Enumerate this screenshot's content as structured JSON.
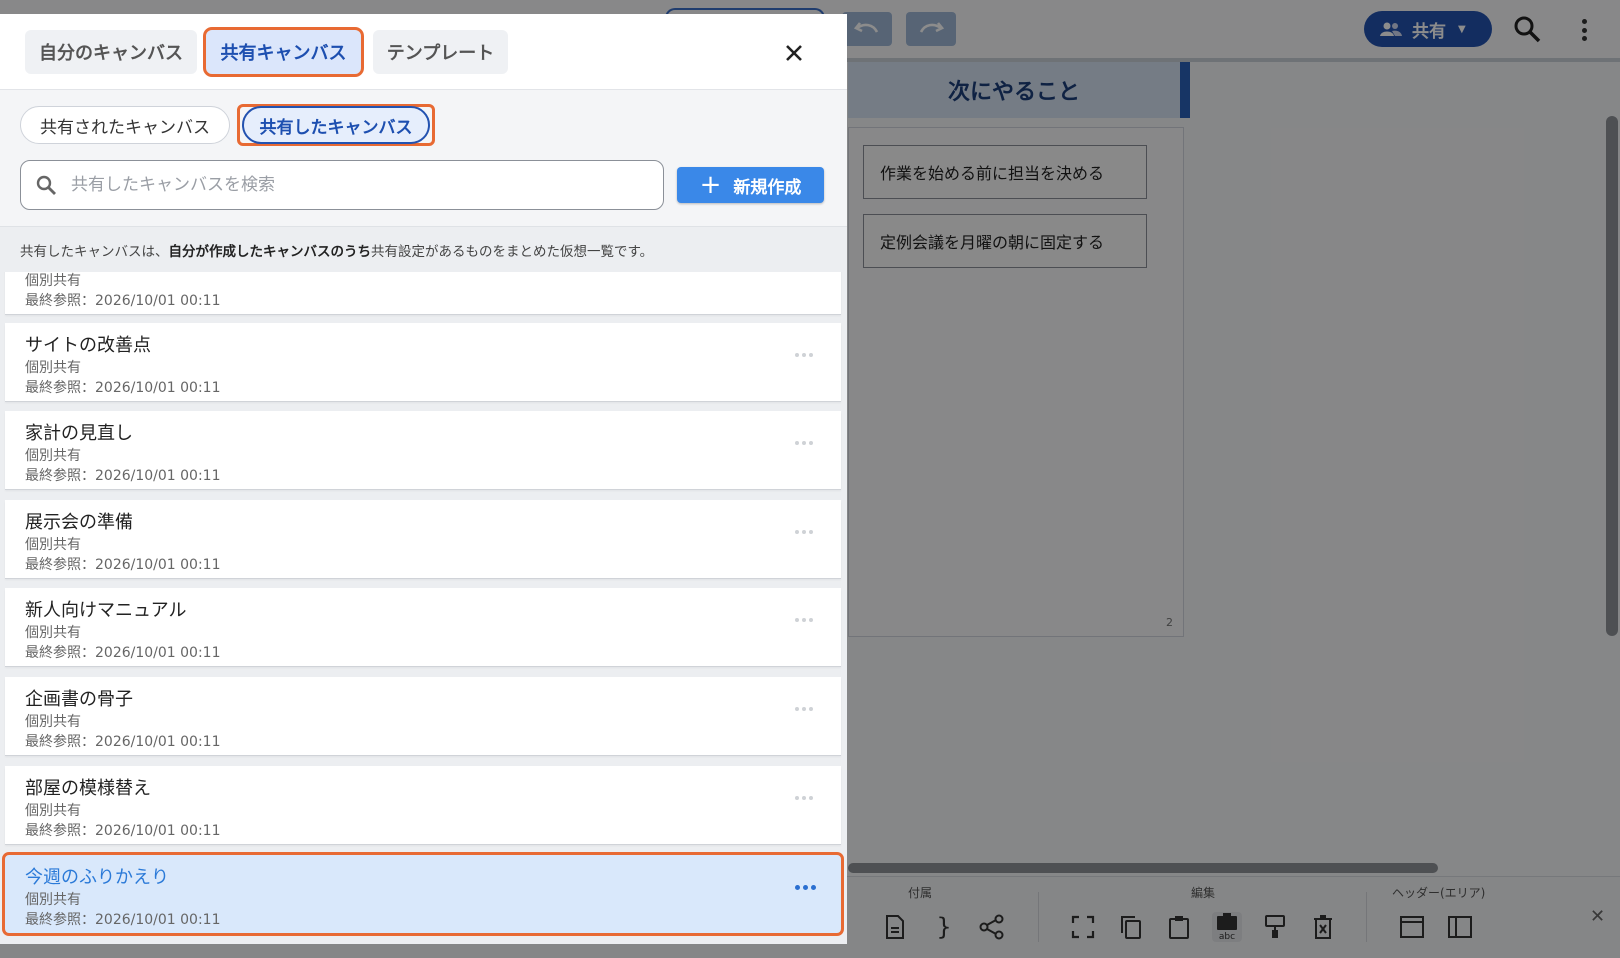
{
  "app": {
    "share_label": "共有",
    "area_title": "次にやること",
    "stickies": [
      "作業を始める前に担当を決める",
      "定例会議を月曜の朝に固定する"
    ],
    "area_count": "2",
    "toolbar_groups": {
      "attach": "付属",
      "edit": "編集",
      "header": "ヘッダー(エリア)"
    }
  },
  "dialog": {
    "tabs": {
      "my": "自分のキャンバス",
      "shared": "共有キャンバス",
      "template": "テンプレート"
    },
    "chips": {
      "received": "共有されたキャンバス",
      "sent": "共有したキャンバス"
    },
    "search": {
      "placeholder": "共有したキャンバスを検索"
    },
    "new_button": "新規作成",
    "info": {
      "part1": "共有したキャンバスは、",
      "bold": "自分が作成したキャンバスのうち",
      "part2": "共有設定があるものをまとめた仮想一覧です。"
    },
    "items": [
      {
        "title": "",
        "sub": "個別共有",
        "date": "最終参照：2026/10/01 00:11"
      },
      {
        "title": "サイトの改善点",
        "sub": "個別共有",
        "date": "最終参照：2026/10/01 00:11"
      },
      {
        "title": "家計の見直し",
        "sub": "個別共有",
        "date": "最終参照：2026/10/01 00:11"
      },
      {
        "title": "展示会の準備",
        "sub": "個別共有",
        "date": "最終参照：2026/10/01 00:11"
      },
      {
        "title": "新人向けマニュアル",
        "sub": "個別共有",
        "date": "最終参照：2026/10/01 00:11"
      },
      {
        "title": "企画書の骨子",
        "sub": "個別共有",
        "date": "最終参照：2026/10/01 00:11"
      },
      {
        "title": "部屋の模様替え",
        "sub": "個別共有",
        "date": "最終参照：2026/10/01 00:11"
      },
      {
        "title": "今週のふりかえり",
        "sub": "個別共有",
        "date": "最終参照：2026/10/01 00:11"
      }
    ],
    "accent_color": "#e86a33",
    "primary_color": "#3a88e8"
  }
}
